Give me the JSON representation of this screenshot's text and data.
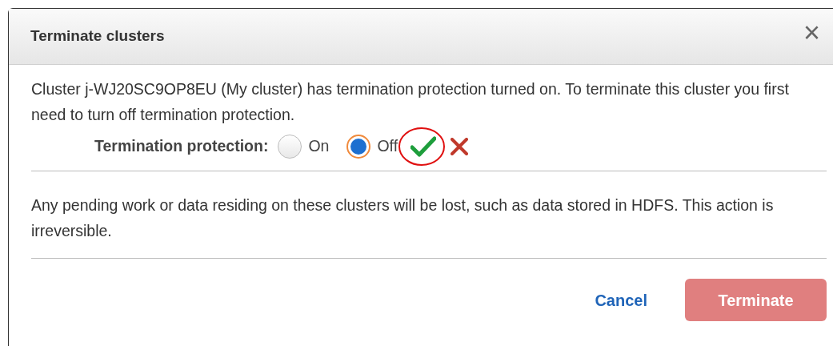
{
  "dialog": {
    "title": "Terminate clusters",
    "close": "×"
  },
  "message": "Cluster j-WJ20SC9OP8EU (My cluster) has termination protection turned on. To terminate this cluster you first need to turn off termination protection.",
  "protection": {
    "label": "Termination protection:",
    "options": [
      {
        "label": "On",
        "selected": false
      },
      {
        "label": "Off",
        "selected": true
      }
    ],
    "highlighted": true
  },
  "warning": "Any pending work or data residing on these clusters will be lost, such as data stored in HDFS. This action is irreversible.",
  "buttons": [
    {
      "label": "Cancel",
      "kind": "link",
      "disabled": false
    },
    {
      "label": "Terminate",
      "kind": "primary",
      "disabled": true
    }
  ]
}
